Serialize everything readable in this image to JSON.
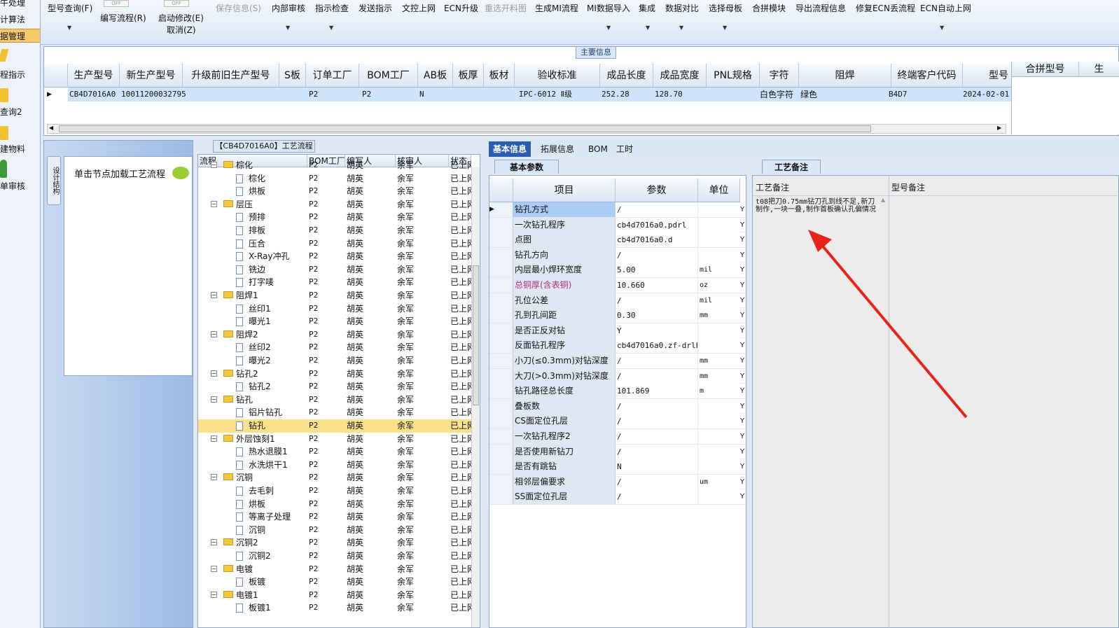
{
  "left_nav": {
    "items": [
      "牛处理",
      "计算法",
      "据管理",
      "程指示",
      "查询2",
      "建物料",
      "单审核"
    ]
  },
  "toolbar": {
    "off_label": "OFF",
    "buttons": [
      {
        "label": "型号查询(F)"
      },
      {
        "label": "编写流程(R)"
      },
      {
        "label": "启动修改(E)"
      },
      {
        "label": "取消(Z)"
      },
      {
        "label": "保存信息(S)"
      },
      {
        "label": "内部审核"
      },
      {
        "label": "指示检查"
      },
      {
        "label": "发送指示"
      },
      {
        "label": "文控上网"
      },
      {
        "label": "ECN升级"
      },
      {
        "label": "重选开料图"
      },
      {
        "label": "生成MI流程"
      },
      {
        "label": "MI数据导入"
      },
      {
        "label": "集成"
      },
      {
        "label": "数据对比"
      },
      {
        "label": "选择母板"
      },
      {
        "label": "合拼模块"
      },
      {
        "label": "导出流程信息"
      },
      {
        "label": "修复ECN丢流程"
      },
      {
        "label": "ECN自动上网"
      }
    ]
  },
  "main_info": {
    "title": "主要信息",
    "columns": [
      "生产型号",
      "新生产型号",
      "升级前旧生产型号",
      "S板",
      "订单工厂",
      "BOM工厂",
      "AB板",
      "板厚",
      "板材",
      "验收标准",
      "成品长度",
      "成品宽度",
      "PNL规格",
      "字符",
      "阻焊",
      "终端客户代码",
      "型号"
    ],
    "row": [
      "CB4D7016A0",
      "10011200032795",
      "",
      "",
      "P2",
      "P2",
      "N",
      "",
      "",
      "IPC-6012 Ⅱ级",
      "252.28",
      "128.70",
      "",
      "白色字符",
      "绿色",
      "B4D7",
      "2024-02-01 1"
    ],
    "right_columns": [
      "合拼型号",
      "生"
    ]
  },
  "left_panel": {
    "vertical_tab": "设计结构",
    "hint": "单击节点加载工艺流程"
  },
  "process": {
    "title": "【CB4D7016A0】工艺流程",
    "columns": [
      "流程",
      "BOM工厂",
      "编写人",
      "核审人",
      "状态"
    ],
    "rows": [
      {
        "name": "棕化",
        "type": "folder",
        "level": 0
      },
      {
        "name": "棕化",
        "type": "file",
        "level": 1
      },
      {
        "name": "烘板",
        "type": "file",
        "level": 1
      },
      {
        "name": "层压",
        "type": "folder",
        "level": 0
      },
      {
        "name": "预排",
        "type": "file",
        "level": 1
      },
      {
        "name": "排板",
        "type": "file",
        "level": 1
      },
      {
        "name": "压合",
        "type": "file",
        "level": 1
      },
      {
        "name": "X-Ray冲孔",
        "type": "file",
        "level": 1
      },
      {
        "name": "铣边",
        "type": "file",
        "level": 1
      },
      {
        "name": "打字唛",
        "type": "file",
        "level": 1
      },
      {
        "name": "阻焊1",
        "type": "folder",
        "level": 0
      },
      {
        "name": "丝印1",
        "type": "file",
        "level": 1
      },
      {
        "name": "曝光1",
        "type": "file",
        "level": 1
      },
      {
        "name": "阻焊2",
        "type": "folder",
        "level": 0
      },
      {
        "name": "丝印2",
        "type": "file",
        "level": 1
      },
      {
        "name": "曝光2",
        "type": "file",
        "level": 1
      },
      {
        "name": "钻孔2",
        "type": "folder",
        "level": 0
      },
      {
        "name": "钻孔2",
        "type": "file",
        "level": 1
      },
      {
        "name": "钻孔",
        "type": "folder",
        "level": 0
      },
      {
        "name": "铝片钻孔",
        "type": "file",
        "level": 1
      },
      {
        "name": "钻孔",
        "type": "file",
        "level": 1,
        "selected": true
      },
      {
        "name": "外层蚀刻1",
        "type": "folder",
        "level": 0
      },
      {
        "name": "热水退膜1",
        "type": "file",
        "level": 1
      },
      {
        "name": "水洗烘干1",
        "type": "file",
        "level": 1
      },
      {
        "name": "沉铜",
        "type": "folder",
        "level": 0
      },
      {
        "name": "去毛刺",
        "type": "file",
        "level": 1
      },
      {
        "name": "烘板",
        "type": "file",
        "level": 1
      },
      {
        "name": "等离子处理",
        "type": "file",
        "level": 1
      },
      {
        "name": "沉铜",
        "type": "file",
        "level": 1
      },
      {
        "name": "沉铜2",
        "type": "folder",
        "level": 0
      },
      {
        "name": "沉铜2",
        "type": "file",
        "level": 1
      },
      {
        "name": "电镀",
        "type": "folder",
        "level": 0
      },
      {
        "name": "板镀",
        "type": "file",
        "level": 1
      },
      {
        "name": "电镀1",
        "type": "folder",
        "level": 0
      },
      {
        "name": "板镀1",
        "type": "file",
        "level": 1
      }
    ],
    "bom_factory": "P2",
    "author": "胡英",
    "reviewer": "余军",
    "status": "已上网"
  },
  "tabs": [
    "基本信息",
    "拓展信息",
    "BOM",
    "工时"
  ],
  "basic_params": {
    "tab_label": "基本参数",
    "columns": [
      "项目",
      "参数",
      "单位"
    ],
    "rows": [
      {
        "item": "钻孔方式",
        "value": "/",
        "unit": ""
      },
      {
        "item": "一次钻孔程序",
        "value": "cb4d7016a0.pdrl",
        "unit": ""
      },
      {
        "item": "点图",
        "value": "cb4d7016a0.d",
        "unit": ""
      },
      {
        "item": "钻孔方向",
        "value": "/",
        "unit": ""
      },
      {
        "item": "内层最小焊环宽度",
        "value": "5.00",
        "unit": "mil"
      },
      {
        "item": "总铜厚(含表铜)",
        "value": "10.660",
        "unit": "oz",
        "highlight": true
      },
      {
        "item": "孔位公差",
        "value": "/",
        "unit": "mil"
      },
      {
        "item": "孔到孔间距",
        "value": "0.30",
        "unit": "mm"
      },
      {
        "item": "是否正反对钻",
        "value": "Y",
        "unit": ""
      },
      {
        "item": "反面钻孔程序",
        "value": "cb4d7016a0.zf-drlb",
        "unit": ""
      },
      {
        "item": "小刀(≤0.3mm)对钻深度",
        "value": "/",
        "unit": "mm"
      },
      {
        "item": "大刀(>0.3mm)对钻深度",
        "value": "/",
        "unit": "mm"
      },
      {
        "item": "钻孔路径总长度",
        "value": "101.869",
        "unit": "m"
      },
      {
        "item": "叠板数",
        "value": "/",
        "unit": ""
      },
      {
        "item": "CS面定位孔层",
        "value": "/",
        "unit": ""
      },
      {
        "item": "一次钻孔程序2",
        "value": "/",
        "unit": ""
      },
      {
        "item": "是否使用新钻刀",
        "value": "/",
        "unit": ""
      },
      {
        "item": "是否有跳钻",
        "value": "N",
        "unit": ""
      },
      {
        "item": "相邻层偏要求",
        "value": "/",
        "unit": "um"
      },
      {
        "item": "SS面定位孔层",
        "value": "/",
        "unit": ""
      }
    ],
    "y_flag": "Y"
  },
  "notes": {
    "tab_label": "工艺备注",
    "process_note_label": "工艺备注",
    "model_note_label": "型号备注",
    "process_note": "t08把刀0.75mm钻刀孔到线不足,新刀制作,一块一叠,制作首板确认孔偏情况"
  },
  "colors": {
    "accent": "#2a5db0",
    "selected_row": "#fbe18a",
    "grid_selected": "#cfe3fb",
    "arrow": "#e8241c",
    "highlight_text": "#b0307a"
  }
}
